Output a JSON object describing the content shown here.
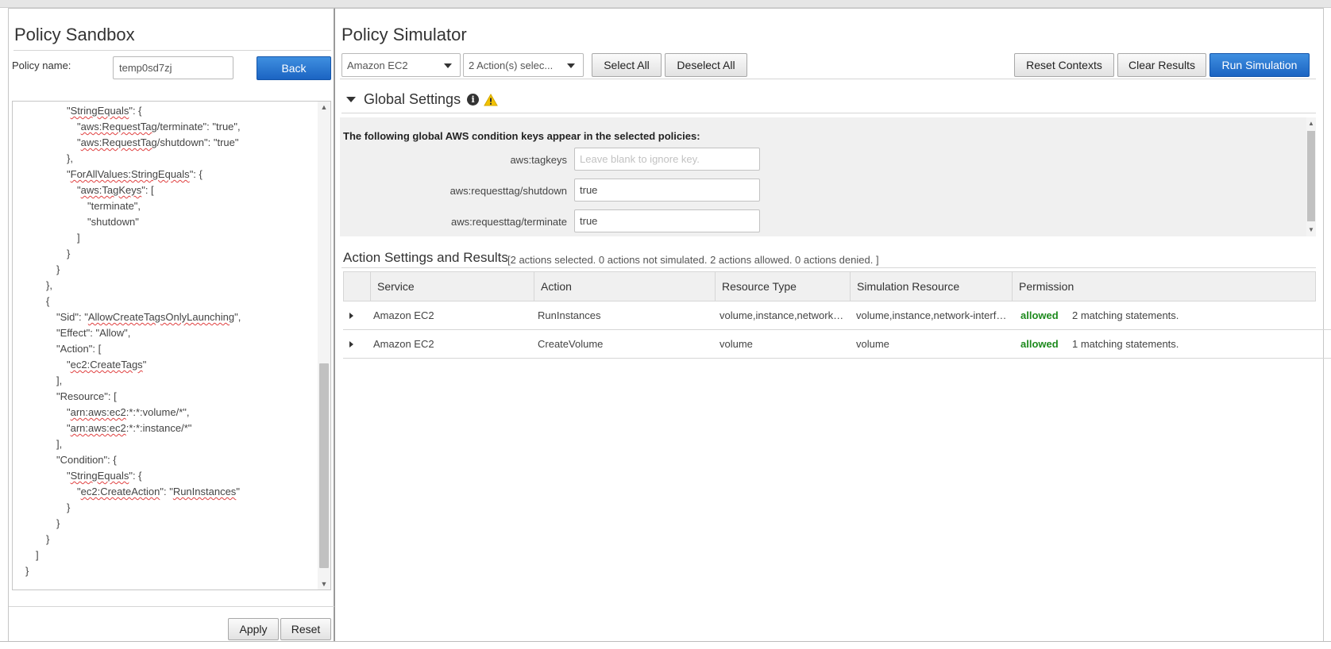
{
  "sandbox": {
    "title": "Policy Sandbox",
    "policy_name_label": "Policy name:",
    "policy_name_value": "temp0sd7zj",
    "back_label": "Back",
    "apply_label": "Apply",
    "reset_label": "Reset",
    "code_lines": [
      {
        "indent": 4,
        "parts": [
          {
            "t": "\""
          },
          {
            "t": "StringEquals",
            "sq": true
          },
          {
            "t": "\": {"
          }
        ]
      },
      {
        "indent": 5,
        "parts": [
          {
            "t": "\""
          },
          {
            "t": "aws:RequestTag",
            "sq": true
          },
          {
            "t": "/terminate\": \"true\","
          }
        ]
      },
      {
        "indent": 5,
        "parts": [
          {
            "t": "\""
          },
          {
            "t": "aws:RequestTag",
            "sq": true
          },
          {
            "t": "/shutdown\": \"true\""
          }
        ]
      },
      {
        "indent": 4,
        "parts": [
          {
            "t": "},"
          }
        ]
      },
      {
        "indent": 4,
        "parts": [
          {
            "t": "\""
          },
          {
            "t": "ForAllValues:StringEquals",
            "sq": true
          },
          {
            "t": "\": {"
          }
        ]
      },
      {
        "indent": 5,
        "parts": [
          {
            "t": "\""
          },
          {
            "t": "aws:TagKeys",
            "sq": true
          },
          {
            "t": "\": ["
          }
        ]
      },
      {
        "indent": 6,
        "parts": [
          {
            "t": "\"terminate\","
          }
        ]
      },
      {
        "indent": 6,
        "parts": [
          {
            "t": "\"shutdown\""
          }
        ]
      },
      {
        "indent": 5,
        "parts": [
          {
            "t": "]"
          }
        ]
      },
      {
        "indent": 4,
        "parts": [
          {
            "t": "}"
          }
        ]
      },
      {
        "indent": 3,
        "parts": [
          {
            "t": "}"
          }
        ]
      },
      {
        "indent": 2,
        "parts": [
          {
            "t": "},"
          }
        ]
      },
      {
        "indent": 2,
        "parts": [
          {
            "t": "{"
          }
        ]
      },
      {
        "indent": 3,
        "parts": [
          {
            "t": "\"Sid\": \""
          },
          {
            "t": "AllowCreateTagsOnlyLaunching",
            "sq": true
          },
          {
            "t": "\","
          }
        ]
      },
      {
        "indent": 3,
        "parts": [
          {
            "t": "\"Effect\": \"Allow\","
          }
        ]
      },
      {
        "indent": 3,
        "parts": [
          {
            "t": "\"Action\": ["
          }
        ]
      },
      {
        "indent": 4,
        "parts": [
          {
            "t": "\""
          },
          {
            "t": "ec2:CreateTags",
            "sq": true
          },
          {
            "t": "\""
          }
        ]
      },
      {
        "indent": 3,
        "parts": [
          {
            "t": "],"
          }
        ]
      },
      {
        "indent": 3,
        "parts": [
          {
            "t": "\"Resource\": ["
          }
        ]
      },
      {
        "indent": 4,
        "parts": [
          {
            "t": "\""
          },
          {
            "t": "arn:aws:ec2",
            "sq": true
          },
          {
            "t": ":*:*:volume/*\","
          }
        ]
      },
      {
        "indent": 4,
        "parts": [
          {
            "t": "\""
          },
          {
            "t": "arn:aws:ec2",
            "sq": true
          },
          {
            "t": ":*:*:instance/*\""
          }
        ]
      },
      {
        "indent": 3,
        "parts": [
          {
            "t": "],"
          }
        ]
      },
      {
        "indent": 3,
        "parts": [
          {
            "t": "\"Condition\": {"
          }
        ]
      },
      {
        "indent": 4,
        "parts": [
          {
            "t": "\""
          },
          {
            "t": "StringEquals",
            "sq": true
          },
          {
            "t": "\": {"
          }
        ]
      },
      {
        "indent": 5,
        "parts": [
          {
            "t": "\""
          },
          {
            "t": "ec2:CreateAction",
            "sq": true
          },
          {
            "t": "\": \""
          },
          {
            "t": "RunInstances",
            "sq": true
          },
          {
            "t": "\""
          }
        ]
      },
      {
        "indent": 4,
        "parts": [
          {
            "t": "}"
          }
        ]
      },
      {
        "indent": 3,
        "parts": [
          {
            "t": "}"
          }
        ]
      },
      {
        "indent": 2,
        "parts": [
          {
            "t": "}"
          }
        ]
      },
      {
        "indent": 1,
        "parts": [
          {
            "t": "]"
          }
        ]
      },
      {
        "indent": 0,
        "parts": [
          {
            "t": "}"
          }
        ]
      }
    ]
  },
  "simulator": {
    "title": "Policy Simulator",
    "service_select": "Amazon EC2",
    "actions_select": "2 Action(s) selec...",
    "select_all_label": "Select All",
    "deselect_all_label": "Deselect All",
    "reset_contexts_label": "Reset Contexts",
    "clear_results_label": "Clear Results",
    "run_simulation_label": "Run Simulation",
    "global_settings": {
      "title": "Global Settings",
      "info_icon": "info-icon",
      "warning_icon": "warning-icon",
      "intro": "The following global AWS condition keys appear in the selected policies:",
      "keys": [
        {
          "label": "aws:tagkeys",
          "value": "",
          "placeholder": "Leave blank to ignore key."
        },
        {
          "label": "aws:requesttag/shutdown",
          "value": "true",
          "placeholder": ""
        },
        {
          "label": "aws:requesttag/terminate",
          "value": "true",
          "placeholder": ""
        }
      ]
    },
    "results": {
      "title": "Action Settings and Results",
      "summary": "[2 actions selected. 0 actions not simulated. 2 actions allowed. 0 actions denied. ]",
      "columns": [
        "Service",
        "Action",
        "Resource Type",
        "Simulation Resource",
        "Permission"
      ],
      "rows": [
        {
          "service": "Amazon EC2",
          "action": "RunInstances",
          "resource_type": "volume,instance,network-i...",
          "simulation_resource": "volume,instance,network-interfa...",
          "permission": "allowed",
          "matching": "2 matching statements."
        },
        {
          "service": "Amazon EC2",
          "action": "CreateVolume",
          "resource_type": "volume",
          "simulation_resource": "volume",
          "permission": "allowed",
          "matching": "1 matching statements."
        }
      ]
    }
  },
  "colors": {
    "primary_button": "#1b64c2",
    "allowed": "#1d8a1d",
    "warning": "#f2c200"
  }
}
